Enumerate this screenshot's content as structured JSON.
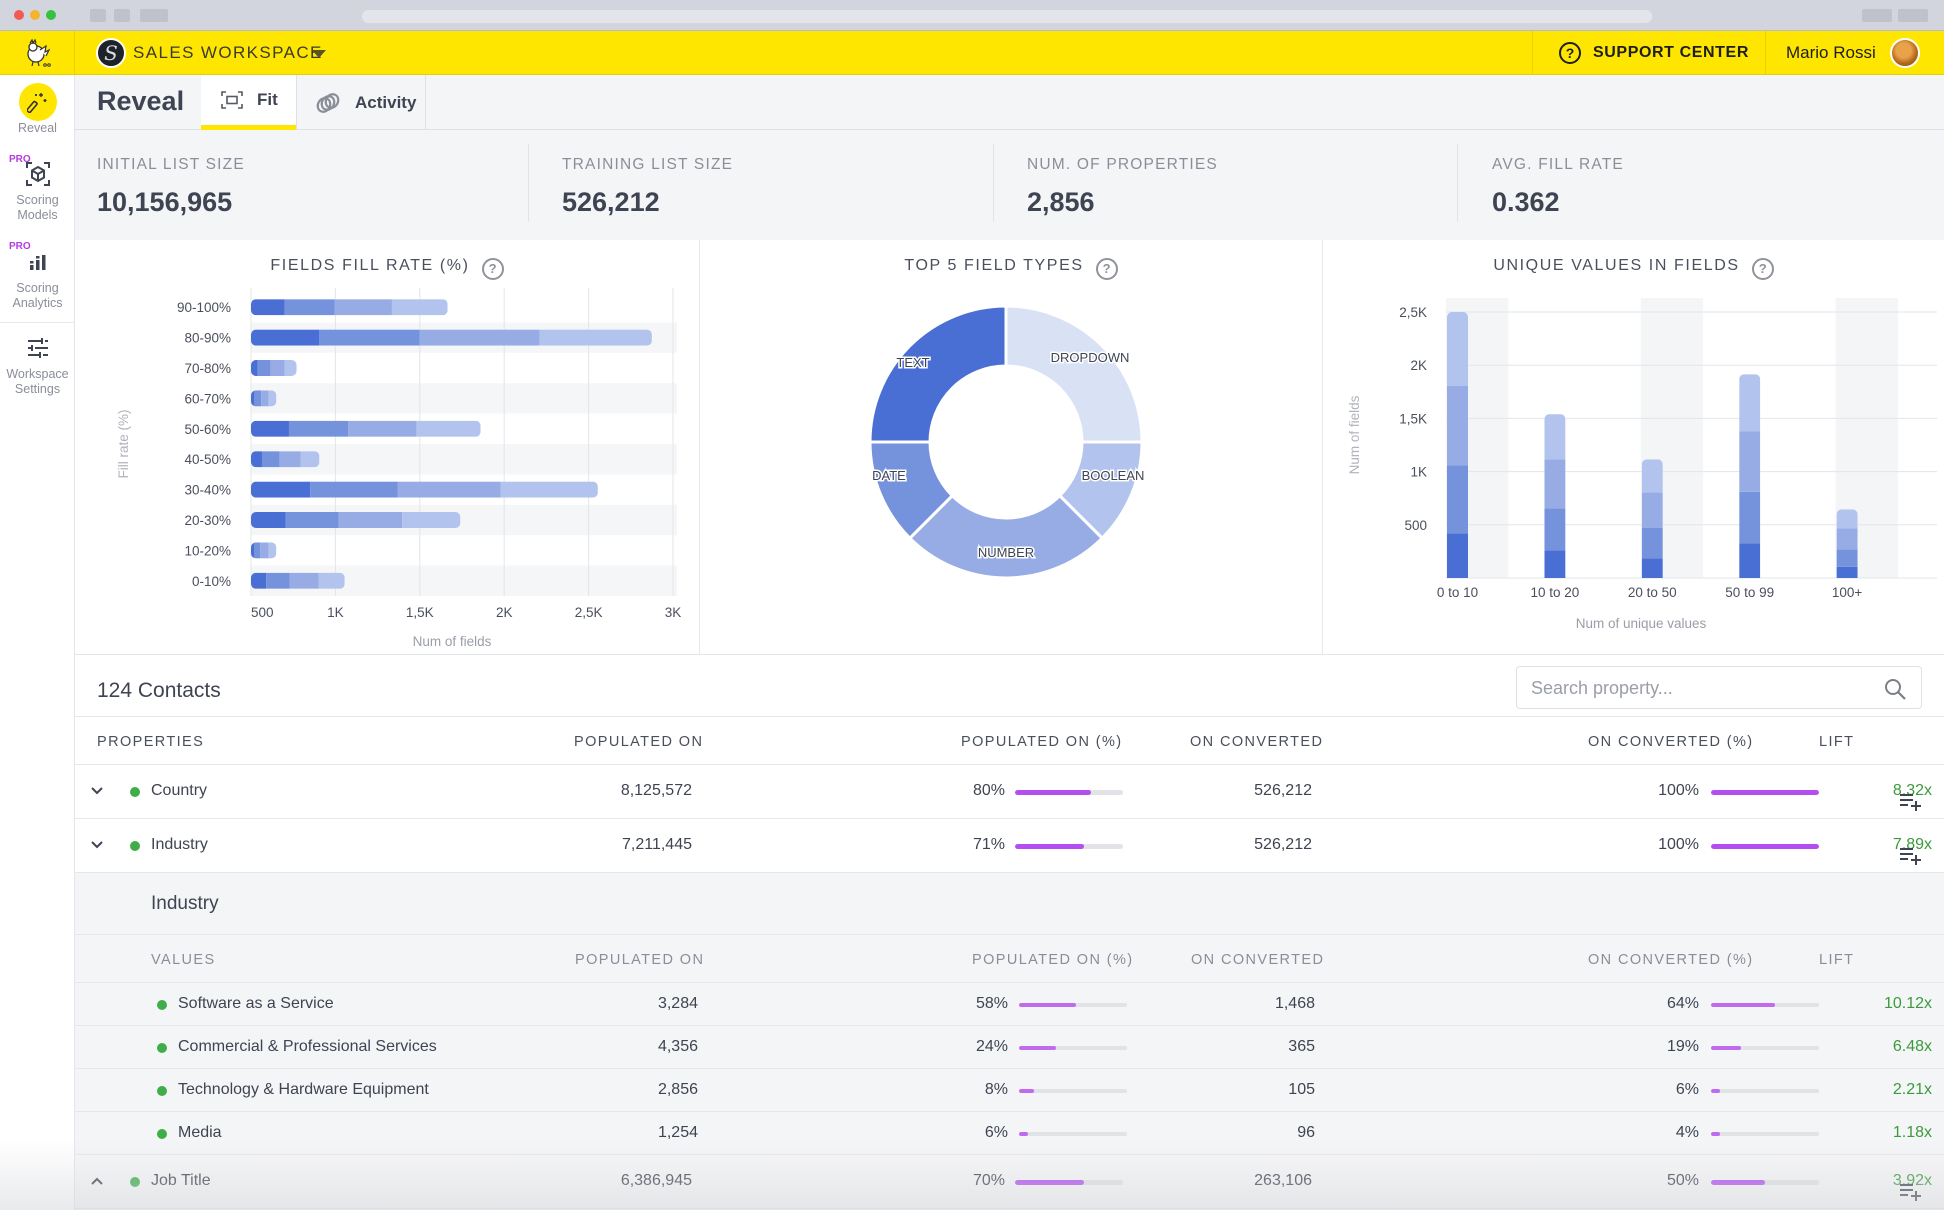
{
  "app": {
    "workspace_name": "SALES WORKSPACE",
    "support_label": "SUPPORT CENTER",
    "user_name": "Mario Rossi"
  },
  "sidebar": {
    "items": [
      {
        "label": "Reveal",
        "icon": "magic-wand-icon",
        "pro": false,
        "active": true
      },
      {
        "label": "Scoring Models",
        "icon": "cube-scan-icon",
        "pro": true
      },
      {
        "label": "Scoring Analytics",
        "icon": "bar-chart-icon",
        "pro": true
      },
      {
        "label": "Workspace Settings",
        "icon": "sliders-icon",
        "pro": false
      }
    ],
    "pro_badge": "PRO"
  },
  "page": {
    "title": "Reveal",
    "tabs": [
      {
        "label": "Fit",
        "icon": "fit-frame-icon",
        "active": true
      },
      {
        "label": "Activity",
        "icon": "activity-rings-icon",
        "active": false
      }
    ]
  },
  "stats": [
    {
      "label": "INITIAL LIST SIZE",
      "value": "10,156,965"
    },
    {
      "label": "TRAINING LIST SIZE",
      "value": "526,212"
    },
    {
      "label": "NUM. OF PROPERTIES",
      "value": "2,856"
    },
    {
      "label": "AVG. FILL RATE",
      "value": "0.362"
    }
  ],
  "colors": {
    "brand_yellow": "#ffe600",
    "series": [
      "#4a6fd4",
      "#7592dc",
      "#97ace4",
      "#b2c3ed"
    ],
    "donut": {
      "TEXT": "#4a6fd4",
      "DROPDOWN": "#d9e1f5",
      "BOOLEAN": "#b2c3ed",
      "NUMBER": "#97ace4",
      "DATE": "#7592dc"
    },
    "progress": "#b34ff0",
    "lift": "#3c9a3c",
    "status_dot": "#3fae4a"
  },
  "chart_data": [
    {
      "type": "bar",
      "orientation": "horizontal",
      "stacked": true,
      "title": "FIELDS FILL RATE (%)",
      "xlabel": "Num of fields",
      "ylabel": "Fill rate (%)",
      "xlim": [
        500,
        3000
      ],
      "xticks": [
        "500",
        "1K",
        "1,5K",
        "2K",
        "2,5K",
        "3K"
      ],
      "xtick_values": [
        500,
        1000,
        1500,
        2000,
        2500,
        3000
      ],
      "grid": true,
      "categories": [
        "90-100%",
        "80-90%",
        "70-80%",
        "60-70%",
        "50-60%",
        "40-50%",
        "30-40%",
        "20-30%",
        "10-20%",
        "0-10%"
      ],
      "cumulative_ends": [
        [
          700,
          995,
          1335,
          1665
        ],
        [
          905,
          1500,
          2210,
          2875
        ],
        [
          540,
          615,
          700,
          770
        ],
        [
          520,
          560,
          605,
          650
        ],
        [
          725,
          1075,
          1480,
          1860
        ],
        [
          565,
          670,
          795,
          905
        ],
        [
          850,
          1370,
          1980,
          2555
        ],
        [
          705,
          1020,
          1395,
          1740
        ],
        [
          520,
          555,
          605,
          650
        ],
        [
          590,
          730,
          900,
          1055
        ]
      ]
    },
    {
      "type": "pie",
      "donut": true,
      "title": "TOP 5 FIELD TYPES",
      "labels": [
        "DROPDOWN",
        "BOOLEAN",
        "NUMBER",
        "DATE",
        "TEXT"
      ],
      "values": [
        25,
        12.5,
        25,
        12.5,
        25
      ],
      "start": "12 o'clock, clockwise"
    },
    {
      "type": "bar",
      "orientation": "vertical",
      "stacked": true,
      "title": "UNIQUE VALUES IN FIELDS",
      "xlabel": "Num of unique values",
      "ylabel": "Num of fields",
      "ylim": [
        0,
        2500
      ],
      "yticks": [
        "500",
        "1K",
        "1,5K",
        "2K",
        "2,5K"
      ],
      "ytick_values": [
        500,
        1000,
        1500,
        2000,
        2500
      ],
      "grid": true,
      "categories": [
        "0 to 10",
        "10 to 20",
        "20 to 50",
        "50 to  99",
        "100+"
      ],
      "cumulative_ends": [
        [
          420,
          1060,
          1805,
          2500
        ],
        [
          260,
          655,
          1115,
          1540
        ],
        [
          185,
          470,
          805,
          1115
        ],
        [
          325,
          810,
          1380,
          1915
        ],
        [
          105,
          270,
          465,
          645
        ]
      ]
    }
  ],
  "contacts": {
    "title": "124 Contacts",
    "search_placeholder": "Search property...",
    "columns": [
      "PROPERTIES",
      "POPULATED ON",
      "POPULATED ON (%)",
      "ON CONVERTED",
      "ON CONVERTED (%)",
      "LIFT"
    ],
    "rows": [
      {
        "name": "Country",
        "populated_on": "8,125,572",
        "populated_pct": "80%",
        "populated_frac": 0.7,
        "on_converted": "526,212",
        "converted_pct": "100%",
        "converted_frac": 1.0,
        "lift": "8.32x",
        "expanded": false
      },
      {
        "name": "Industry",
        "populated_on": "7,211,445",
        "populated_pct": "71%",
        "populated_frac": 0.64,
        "on_converted": "526,212",
        "converted_pct": "100%",
        "converted_frac": 1.0,
        "lift": "7.89x",
        "expanded": true
      }
    ],
    "expanded": {
      "title": "Industry",
      "columns": [
        "VALUES",
        "POPULATED ON",
        "POPULATED ON (%)",
        "ON CONVERTED",
        "ON CONVERTED (%)",
        "LIFT"
      ],
      "rows": [
        {
          "name": "Software as a Service",
          "populated_on": "3,284",
          "populated_pct": "58%",
          "populated_frac": 0.53,
          "on_converted": "1,468",
          "converted_pct": "64%",
          "converted_frac": 0.59,
          "lift": "10.12x"
        },
        {
          "name": "Commercial & Professional Services",
          "populated_on": "4,356",
          "populated_pct": "24%",
          "populated_frac": 0.34,
          "on_converted": "365",
          "converted_pct": "19%",
          "converted_frac": 0.28,
          "lift": "6.48x"
        },
        {
          "name": "Technology & Hardware Equipment",
          "populated_on": "2,856",
          "populated_pct": "8%",
          "populated_frac": 0.14,
          "on_converted": "105",
          "converted_pct": "6%",
          "converted_frac": 0.08,
          "lift": "2.21x"
        },
        {
          "name": "Media",
          "populated_on": "1,254",
          "populated_pct": "6%",
          "populated_frac": 0.08,
          "on_converted": "96",
          "converted_pct": "4%",
          "converted_frac": 0.08,
          "lift": "1.18x"
        }
      ]
    },
    "last_row": {
      "name": "Job Title",
      "populated_on": "6,386,945",
      "populated_pct": "70%",
      "populated_frac": 0.64,
      "on_converted": "263,106",
      "converted_pct": "50%",
      "converted_frac": 0.5,
      "lift": "3.92x"
    }
  }
}
